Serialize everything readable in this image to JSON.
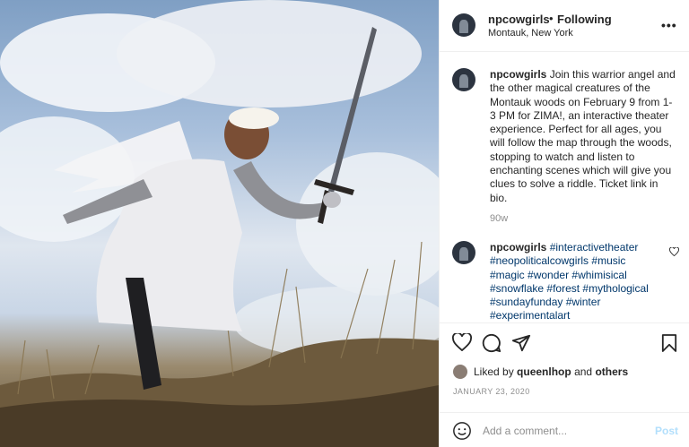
{
  "post": {
    "username": "npcowgirls",
    "separator": "•",
    "follow_status": "Following",
    "location": "Montauk, New York",
    "more_icon": "more-horizontal-icon"
  },
  "caption": {
    "username": "npcowgirls",
    "text": "Join this warrior angel and the other magical creatures of the Montauk woods on February 9 from 1-3 PM for ZIMA!, an interactive theater experience. Perfect for all ages, you will follow the map through the woods, stopping to watch and listen to enchanting scenes which will give you clues to solve a riddle. Ticket link in bio.",
    "time": "90w"
  },
  "comment": {
    "username": "npcowgirls",
    "hashtags": [
      "#interactivetheater",
      "#neopoliticalcowgirls",
      "#music",
      "#magic",
      "#wonder",
      "#whimisical",
      "#snowflake",
      "#forest",
      "#mythological",
      "#sundayfunday",
      "#winter",
      "#experimentalart"
    ]
  },
  "likes": {
    "prefix": "Liked by",
    "user": "queenlhop",
    "joiner": "and",
    "others": "others"
  },
  "date": "JANUARY 23, 2020",
  "add_comment": {
    "placeholder": "Add a comment...",
    "post_label": "Post"
  },
  "colors": {
    "link": "#00376b",
    "muted": "#8e8e8e",
    "post_disabled": "#b2dffc"
  }
}
